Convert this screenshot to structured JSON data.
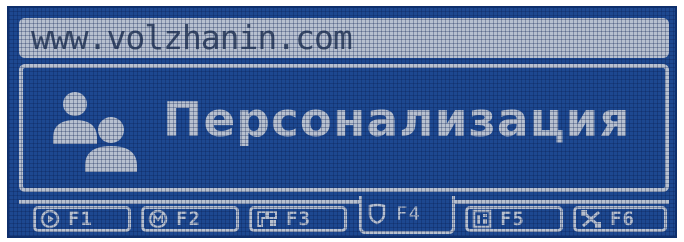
{
  "url": "www.volzhanin.com",
  "screen": {
    "title": "Персонализация",
    "icon": "users-icon"
  },
  "tabs": [
    {
      "icon": "play-circle-icon",
      "label": "F1",
      "active": false
    },
    {
      "icon": "m-circle-icon",
      "label": "F2",
      "active": false
    },
    {
      "icon": "wrench-icon",
      "label": "F3",
      "active": false
    },
    {
      "icon": "shield-icon",
      "label": "F4",
      "active": true
    },
    {
      "icon": "document-icon",
      "label": "F5",
      "active": false
    },
    {
      "icon": "tools-icon",
      "label": "F6",
      "active": false
    }
  ],
  "colors": {
    "background": "#1d4890",
    "foreground": "#b7c0cf"
  }
}
